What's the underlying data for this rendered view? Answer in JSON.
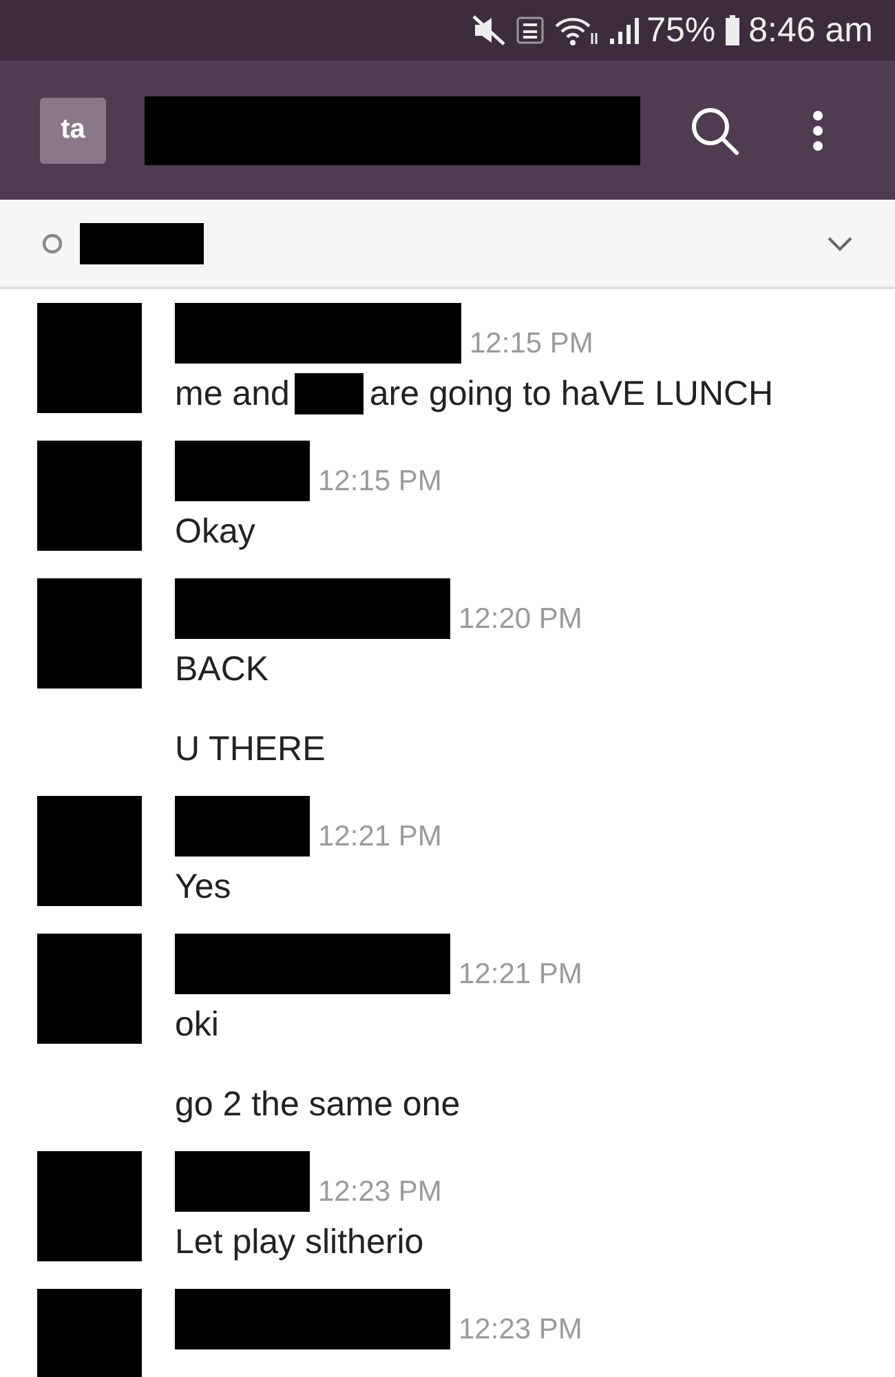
{
  "status_bar": {
    "battery": "75%",
    "time": "8:46 am"
  },
  "header": {
    "workspace_badge": "ta"
  },
  "messages": [
    {
      "time": "12:15 PM",
      "lines": [
        [
          "me and",
          "are going to haVE LUNCH"
        ]
      ]
    },
    {
      "time": "12:15 PM",
      "lines": [
        [
          "Okay"
        ]
      ]
    },
    {
      "time": "12:20 PM",
      "lines": [
        [
          "BACK"
        ],
        [
          "U THERE"
        ]
      ]
    },
    {
      "time": "12:21 PM",
      "lines": [
        [
          "Yes"
        ]
      ]
    },
    {
      "time": "12:21 PM",
      "lines": [
        [
          "oki"
        ],
        [
          "go 2 the same one"
        ]
      ]
    },
    {
      "time": "12:23 PM",
      "lines": [
        [
          "Let play slitherio"
        ]
      ]
    },
    {
      "time": "12:23 PM"
    }
  ]
}
